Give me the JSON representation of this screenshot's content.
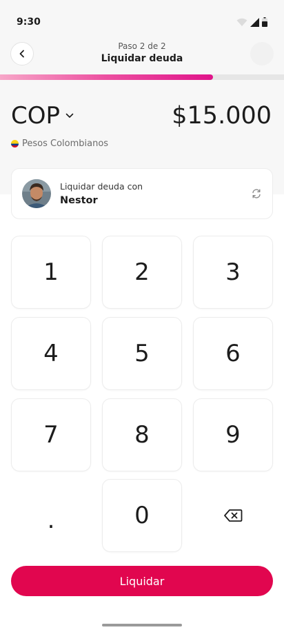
{
  "status_bar": {
    "time": "9:30"
  },
  "header": {
    "step": "Paso 2 de 2",
    "title": "Liquidar deuda"
  },
  "progress": {
    "fraction": 0.75
  },
  "amount": {
    "currency_code": "COP",
    "value": "$15.000",
    "currency_name": "Pesos Colombianos"
  },
  "debt_card": {
    "label": "Liquidar deuda con",
    "name": "Nestor"
  },
  "keypad": {
    "keys": [
      "1",
      "2",
      "3",
      "4",
      "5",
      "6",
      "7",
      "8",
      "9",
      ".",
      "0"
    ]
  },
  "actions": {
    "submit_label": "Liquidar"
  },
  "colors": {
    "accent": "#e1064f",
    "progress_gradient_end": "#e0148a",
    "background_soft": "#f7f7f7"
  }
}
